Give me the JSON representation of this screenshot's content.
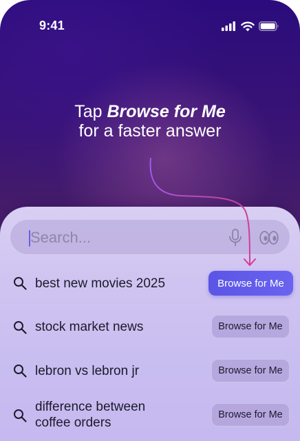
{
  "status_bar": {
    "time": "9:41"
  },
  "headline": {
    "prefix": "Tap ",
    "emphasis": "Browse for Me",
    "line2": "for a faster answer"
  },
  "search": {
    "placeholder": "Search..."
  },
  "suggestions": [
    {
      "query": "best new movies 2025",
      "button": "Browse for Me",
      "highlighted": true
    },
    {
      "query": "stock market news",
      "button": "Browse for Me",
      "highlighted": false
    },
    {
      "query": "lebron vs lebron jr",
      "button": "Browse for Me",
      "highlighted": false
    },
    {
      "query_line1": "difference between",
      "query_line2": "coffee orders",
      "button": "Browse for Me",
      "highlighted": false
    }
  ],
  "colors": {
    "accent": "#5b55e6",
    "arrow": "#d63a9a",
    "caret": "#6a5ee8"
  },
  "icons": [
    "cellular-signal-icon",
    "wifi-icon",
    "battery-icon",
    "microphone-icon",
    "eyes-icon",
    "search-icon",
    "arrow-icon"
  ]
}
